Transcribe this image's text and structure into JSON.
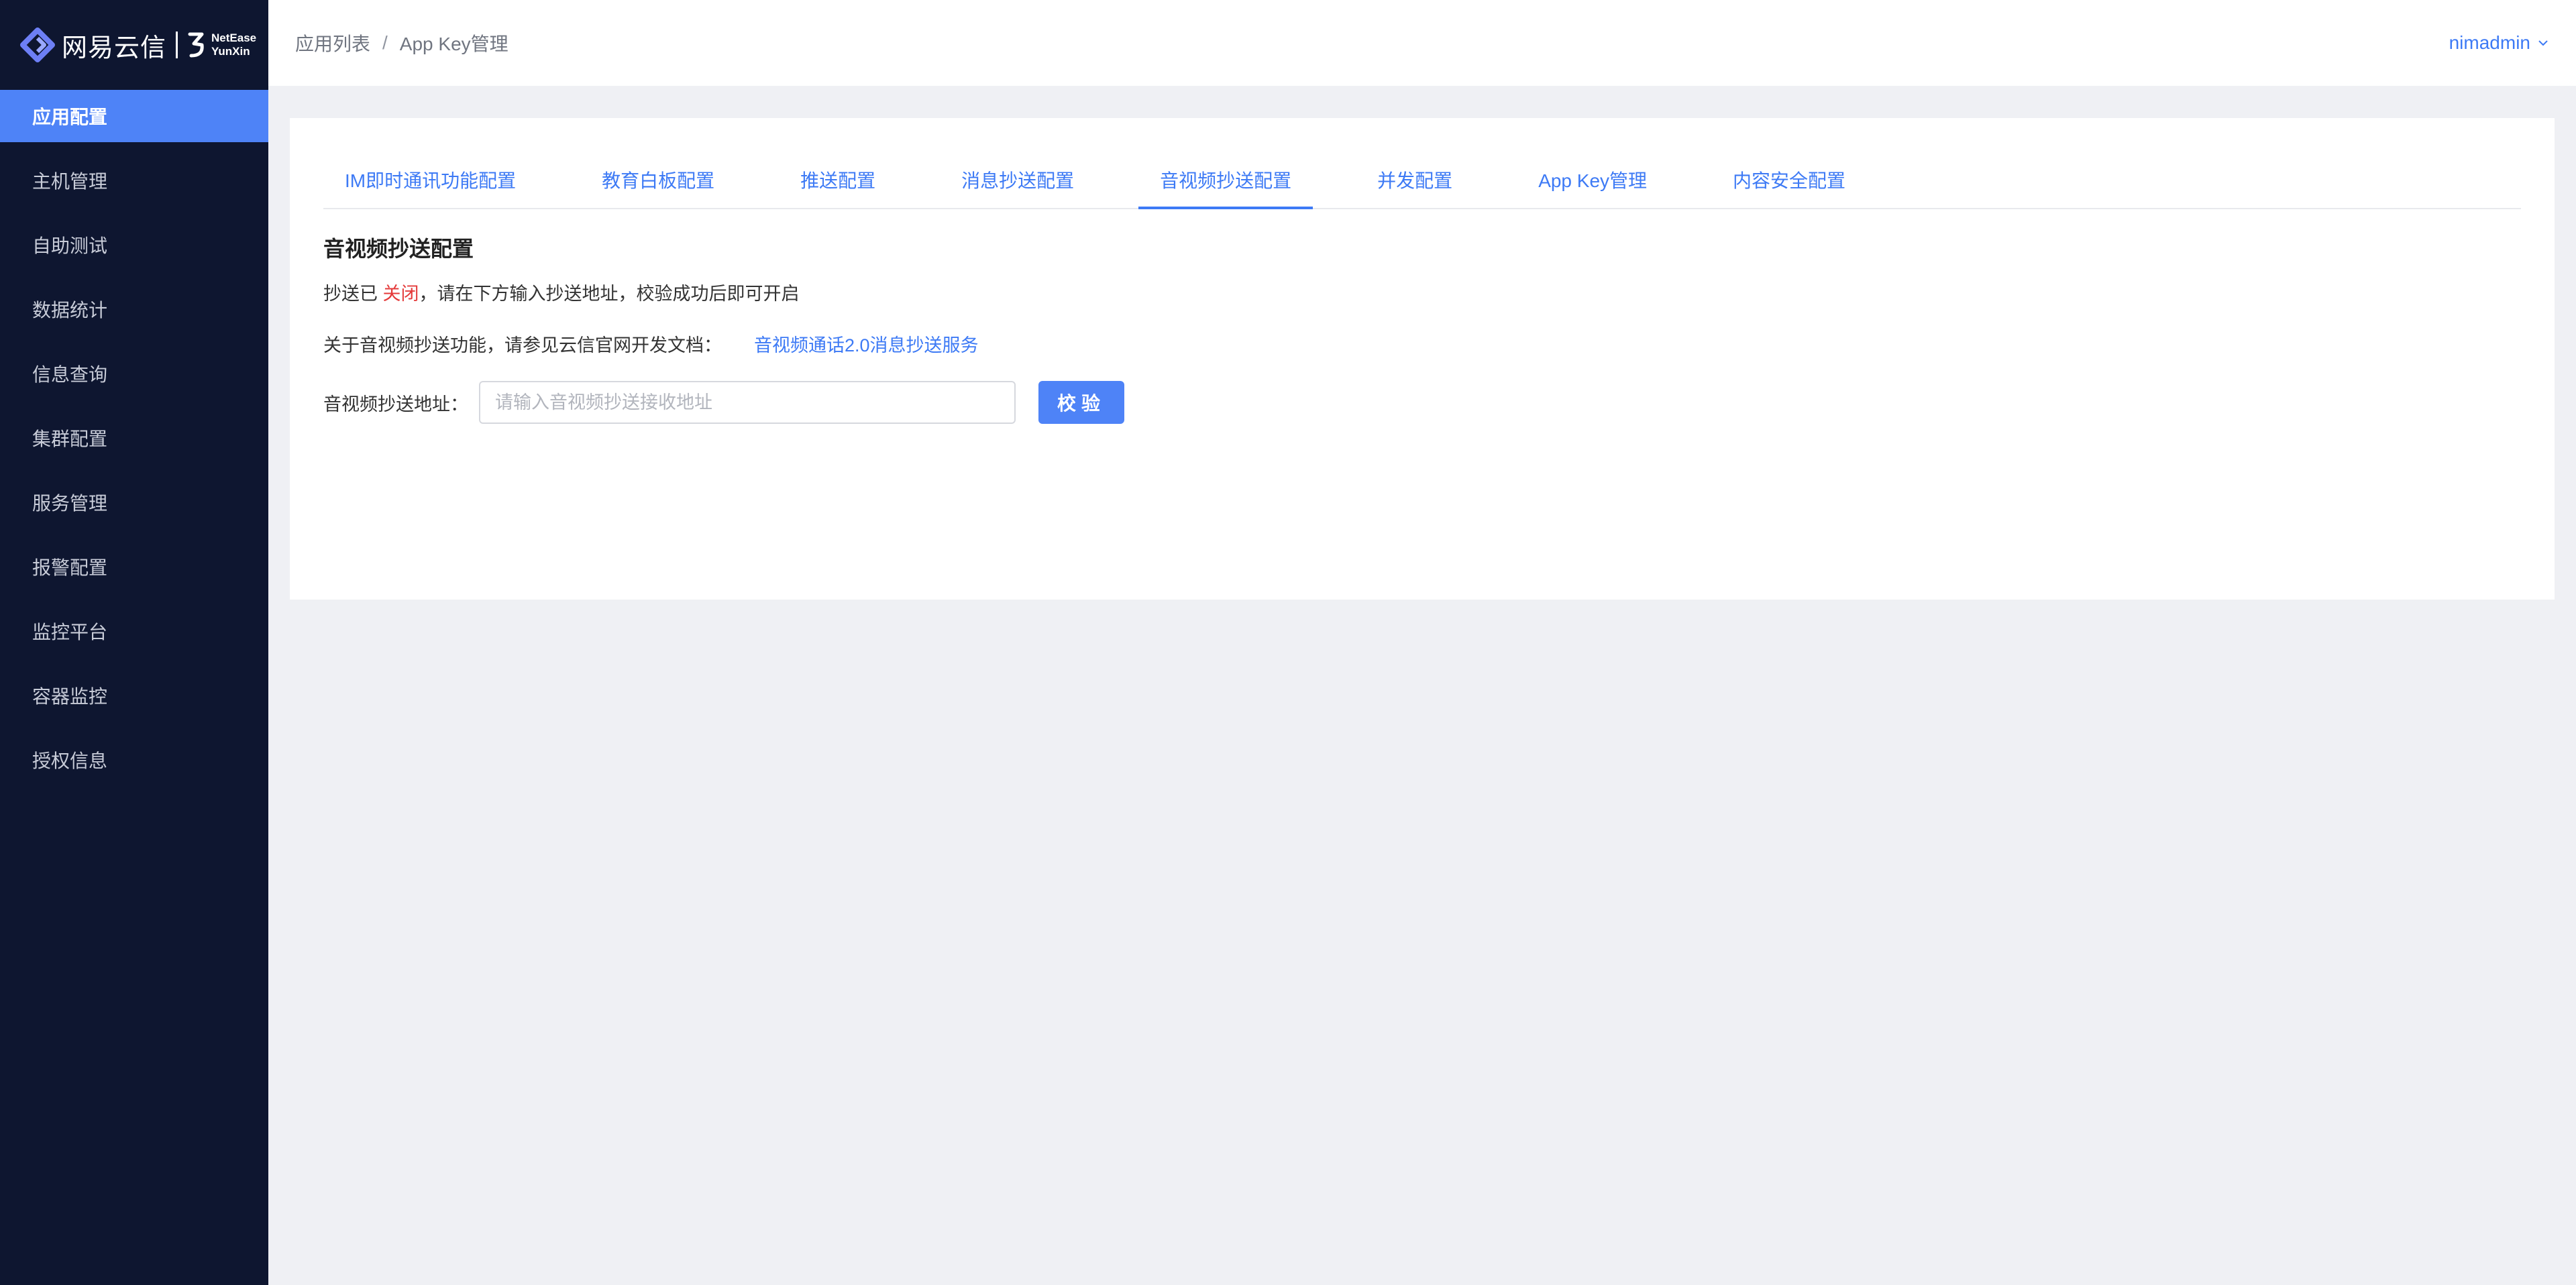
{
  "brand": {
    "name_cn": "网易云信",
    "name_en_line1": "NetEase",
    "name_en_line2": "YunXin",
    "accent_color": "#4e83f7",
    "sidebar_bg": "#0e1630"
  },
  "sidebar": {
    "items": [
      {
        "label": "应用配置",
        "active": true
      },
      {
        "label": "主机管理"
      },
      {
        "label": "自助测试"
      },
      {
        "label": "数据统计"
      },
      {
        "label": "信息查询"
      },
      {
        "label": "集群配置"
      },
      {
        "label": "服务管理"
      },
      {
        "label": "报警配置"
      },
      {
        "label": "监控平台"
      },
      {
        "label": "容器监控"
      },
      {
        "label": "授权信息"
      }
    ]
  },
  "header": {
    "breadcrumb": [
      "应用列表",
      "App Key管理"
    ],
    "breadcrumb_separator": "/",
    "user": "nimadmin"
  },
  "tabs": [
    {
      "label": "IM即时通讯功能配置"
    },
    {
      "label": "教育白板配置"
    },
    {
      "label": "推送配置"
    },
    {
      "label": "消息抄送配置"
    },
    {
      "label": "音视频抄送配置",
      "active": true
    },
    {
      "label": "并发配置"
    },
    {
      "label": "App Key管理"
    },
    {
      "label": "内容安全配置"
    }
  ],
  "content": {
    "title": "音视频抄送配置",
    "status_prefix": "抄送已",
    "status_value": "关闭",
    "status_suffix": "，请在下方输入抄送地址，校验成功后即可开启",
    "doc_text": "关于音视频抄送功能，请参见云信官网开发文档：",
    "doc_link": "音视频通话2.0消息抄送服务",
    "field_label": "音视频抄送地址：",
    "field_value": "",
    "field_placeholder": "请输入音视频抄送接收地址",
    "verify_button": "校验"
  }
}
